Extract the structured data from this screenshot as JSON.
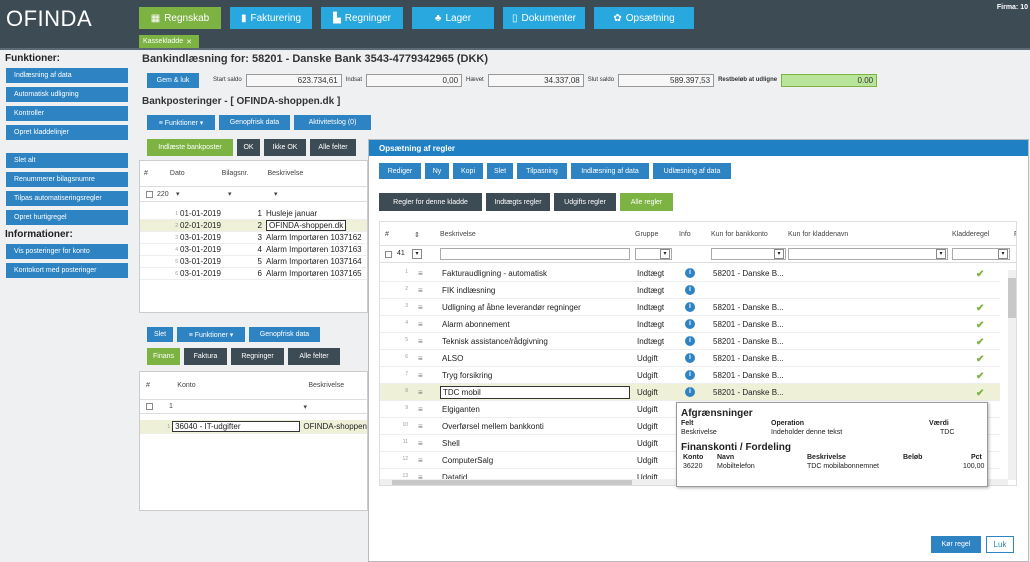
{
  "app": {
    "logo": "OFINDA",
    "firma": "Firma: 10"
  },
  "nav": [
    {
      "label": "Regnskab",
      "icon": "calculator-icon",
      "glyph": "▦"
    },
    {
      "label": "Fakturering",
      "icon": "document-icon",
      "glyph": "▮"
    },
    {
      "label": "Regninger",
      "icon": "bills-icon",
      "glyph": "▙"
    },
    {
      "label": "Lager",
      "icon": "cubes-icon",
      "glyph": "♣"
    },
    {
      "label": "Dokumenter",
      "icon": "file-icon",
      "glyph": "▯"
    },
    {
      "label": "Opsætning",
      "icon": "gear-icon",
      "glyph": "✿"
    }
  ],
  "active_tab": "Kassekladde",
  "sidebar": {
    "funktioner_title": "Funktioner:",
    "funktioner": [
      "Indlæsning af data",
      "Automatisk udligning",
      "Kontroller",
      "Opret kladdelinjer"
    ],
    "funktioner2": [
      "Slet alt",
      "Renummerer bilagsnumre",
      "Tilpas automatiseringsregler",
      "Opret hurtigregel"
    ],
    "informationer_title": "Informationer:",
    "informationer": [
      "Vis posteringer for konto",
      "Kontokort med posteringer"
    ]
  },
  "bank": {
    "title": "Bankindlæsning for: 58201 - Danske Bank 3543-4779342965 (DKK)",
    "gem_label": "Gem & luk",
    "start_label": "Start saldo",
    "start_value": "623.734,61",
    "indsat_label": "Indsat",
    "indsat_value": "0,00",
    "haevet_label": "Hævet",
    "haevet_value": "34.337,08",
    "slut_label": "Slut saldo",
    "slut_value": "589.397,53",
    "rest_label": "Restbeløb at udligne",
    "rest_value": "0.00"
  },
  "bankpost": {
    "title": "Bankposteringer - [ OFINDA-shoppen.dk ]",
    "funktioner": "≡ Funktioner ▾",
    "genopfrisk": "Genopfrisk data",
    "aktivitetslog": "Aktivitetslog (0)",
    "tabs": [
      "Indlæste bankposter",
      "OK",
      "Ikke OK",
      "Alle felter"
    ],
    "headers": {
      "num": "#",
      "dato": "Dato",
      "bilag": "Bilagsnr.",
      "beskrivelse": "Beskrivelse"
    },
    "count": "220",
    "rows": [
      {
        "n": "1",
        "dato": "01-01-2019",
        "bilag": "1",
        "besk": "Husleje januar"
      },
      {
        "n": "2",
        "dato": "02-01-2019",
        "bilag": "2",
        "besk": "OFINDA-shoppen.dk"
      },
      {
        "n": "3",
        "dato": "03-01-2019",
        "bilag": "3",
        "besk": "Alarm Importøren 1037162"
      },
      {
        "n": "4",
        "dato": "03-01-2019",
        "bilag": "4",
        "besk": "Alarm Importøren 1037163"
      },
      {
        "n": "5",
        "dato": "03-01-2019",
        "bilag": "5",
        "besk": "Alarm Importøren 1037164"
      },
      {
        "n": "6",
        "dato": "03-01-2019",
        "bilag": "6",
        "besk": "Alarm Importøren 1037165"
      }
    ]
  },
  "lower": {
    "slet": "Slet",
    "funktioner": "≡ Funktioner ▾",
    "genopfrisk": "Genopfrisk data",
    "tabs": [
      "Finans",
      "Faktura",
      "Regninger",
      "Alle felter"
    ],
    "headers": {
      "num": "#",
      "konto": "Konto",
      "beskrivelse": "Beskrivelse"
    },
    "count": "1",
    "row": {
      "n": "1",
      "konto": "36040 - IT-udgifter",
      "besk": "OFINDA-shoppen"
    }
  },
  "modal": {
    "title": "Opsætning af regler",
    "toolbar": [
      "Rediger",
      "Ny",
      "Kopi",
      "Slet",
      "Tilpasning",
      "Indlæsning af data",
      "Udlæsning af data"
    ],
    "tabs": [
      "Regler for denne kladde",
      "Indtægts regler",
      "Udgifts regler",
      "Alle regler"
    ],
    "headers": {
      "num": "#",
      "sort": "⇕",
      "beskrivelse": "Beskrivelse",
      "gruppe": "Gruppe",
      "info": "Info",
      "kunbank": "Kun for bankkonto",
      "kunkladde": "Kun for kladdenavn",
      "kladderegel": "Kladderegel",
      "f": "F"
    },
    "count": "41",
    "rows": [
      {
        "n": "1",
        "besk": "Fakturaudligning - automatisk",
        "gruppe": "Indtægt",
        "bank": "58201 - Danske B...",
        "chk": true
      },
      {
        "n": "2",
        "besk": "FIK indlæsning",
        "gruppe": "Indtægt",
        "bank": "",
        "chk": false
      },
      {
        "n": "3",
        "besk": "Udligning af åbne leverandør regninger",
        "gruppe": "Indtægt",
        "bank": "58201 - Danske B...",
        "chk": true
      },
      {
        "n": "4",
        "besk": "Alarm abonnement",
        "gruppe": "Indtægt",
        "bank": "58201 - Danske B...",
        "chk": true
      },
      {
        "n": "5",
        "besk": "Teknisk assistance/rådgivning",
        "gruppe": "Indtægt",
        "bank": "58201 - Danske B...",
        "chk": true
      },
      {
        "n": "6",
        "besk": "ALSO",
        "gruppe": "Udgift",
        "bank": "58201 - Danske B...",
        "chk": true
      },
      {
        "n": "7",
        "besk": "Tryg forsikring",
        "gruppe": "Udgift",
        "bank": "58201 - Danske B...",
        "chk": true
      },
      {
        "n": "8",
        "besk": "TDC mobil",
        "gruppe": "Udgift",
        "bank": "58201 - Danske B...",
        "chk": true
      },
      {
        "n": "9",
        "besk": "Elgiganten",
        "gruppe": "Udgift",
        "bank": "58201 - Danske B...",
        "chk": false
      },
      {
        "n": "10",
        "besk": "Overførsel mellem bankkonti",
        "gruppe": "Udgift",
        "bank": "",
        "chk": false
      },
      {
        "n": "11",
        "besk": "Shell",
        "gruppe": "Udgift",
        "bank": "",
        "chk": false
      },
      {
        "n": "12",
        "besk": "ComputerSalg",
        "gruppe": "Udgift",
        "bank": "",
        "chk": false
      },
      {
        "n": "13",
        "besk": "Datatid",
        "gruppe": "Udgift",
        "bank": "",
        "chk": false
      }
    ],
    "kor": "Kør regel",
    "luk": "Luk",
    "info_glyph": "i",
    "check_glyph": "✔"
  },
  "tooltip": {
    "title1": "Afgrænsninger",
    "h_felt": "Felt",
    "h_operation": "Operation",
    "h_vaerdi": "Værdi",
    "felt": "Beskrivelse",
    "operation": "Indeholder denne tekst",
    "vaerdi": "TDC",
    "title2": "Finanskonti / Fordeling",
    "h_konto": "Konto",
    "h_navn": "Navn",
    "h_besk": "Beskrivelse",
    "h_belob": "Beløb",
    "h_pct": "Pct",
    "konto": "36220",
    "navn": "Mobiltelefon",
    "besk": "TDC mobilabonnemnet",
    "pct": "100,00"
  },
  "colors": {
    "topbar": "#3d4b55",
    "blue": "#29a8e0",
    "green": "#7cb342",
    "modalhead": "#1f80c4"
  }
}
